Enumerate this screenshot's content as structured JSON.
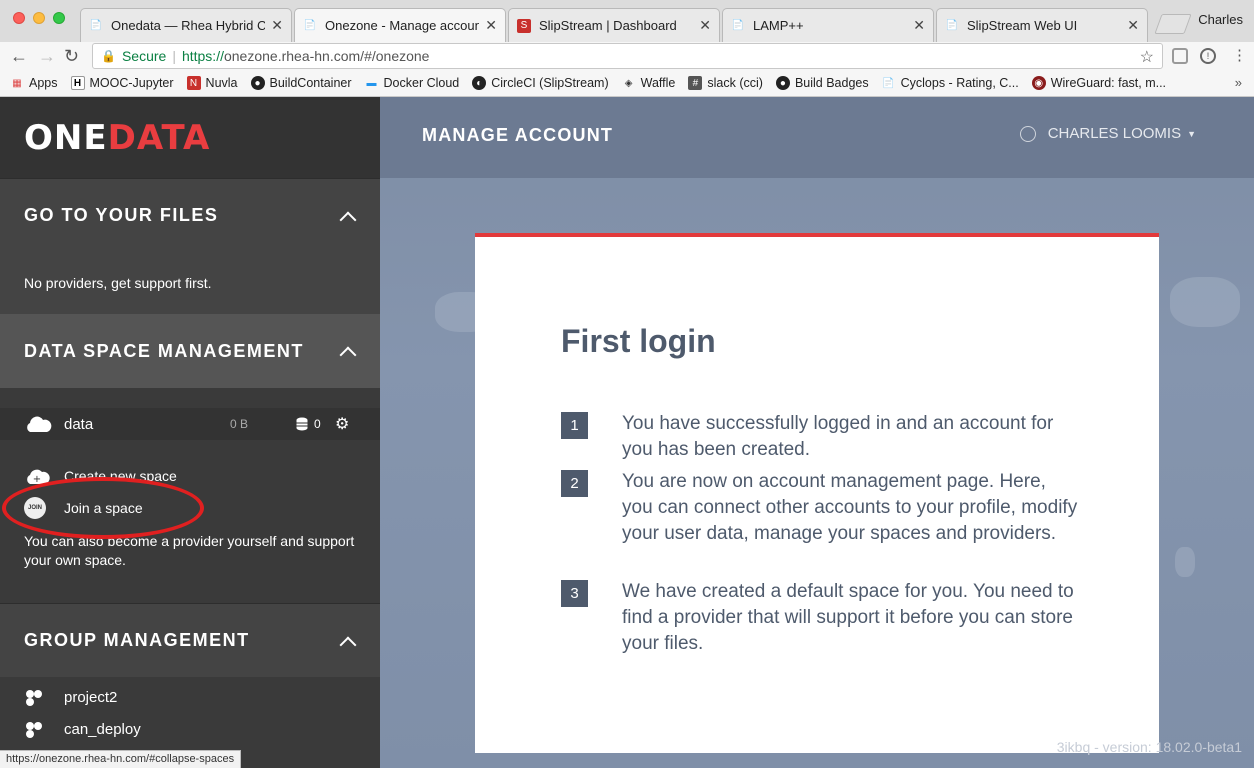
{
  "browser": {
    "profile": "Charles",
    "tabs": [
      {
        "title": "Onedata — Rhea Hybrid Clo",
        "icon": "page-icon",
        "active": false
      },
      {
        "title": "Onezone - Manage account",
        "icon": "page-icon",
        "active": true
      },
      {
        "title": "SlipStream | Dashboard",
        "icon": "slipstream-icon",
        "active": false
      },
      {
        "title": "LAMP++",
        "icon": "page-icon",
        "active": false
      },
      {
        "title": "SlipStream Web UI",
        "icon": "page-icon",
        "active": false
      }
    ],
    "secure_label": "Secure",
    "url_scheme": "https://",
    "url_rest": "onezone.rhea-hn.com/#/onezone",
    "bookmarks": [
      {
        "label": "Apps",
        "icon": "apps-grid-icon"
      },
      {
        "label": "MOOC-Jupyter",
        "icon": "jupyter-icon"
      },
      {
        "label": "Nuvla",
        "icon": "nuvla-icon"
      },
      {
        "label": "BuildContainer",
        "icon": "github-icon"
      },
      {
        "label": "Docker Cloud",
        "icon": "docker-icon"
      },
      {
        "label": "CircleCI (SlipStream)",
        "icon": "circleci-icon"
      },
      {
        "label": "Waffle",
        "icon": "waffle-icon"
      },
      {
        "label": "slack (cci)",
        "icon": "slack-icon"
      },
      {
        "label": "Build Badges",
        "icon": "github-icon"
      },
      {
        "label": "Cyclops - Rating, C...",
        "icon": "page-icon"
      },
      {
        "label": "WireGuard: fast, m...",
        "icon": "wireguard-icon"
      }
    ],
    "status_url": "https://onezone.rhea-hn.com/#collapse-spaces"
  },
  "sidebar": {
    "logo_one": "ONE",
    "logo_data": "DATA",
    "files": {
      "title": "GO TO YOUR FILES",
      "message": "No providers, get support first."
    },
    "spaces": {
      "title": "DATA SPACE MANAGEMENT",
      "items": [
        {
          "name": "data",
          "size": "0 B",
          "providers": "0"
        }
      ],
      "create_label": "Create new space",
      "join_label": "Join a space",
      "join_icon_text": "JOIN",
      "provider_note": "You can also become a provider yourself and support your own space."
    },
    "groups": {
      "title": "GROUP MANAGEMENT",
      "items": [
        "project2",
        "can_deploy"
      ]
    }
  },
  "main": {
    "title": "MANAGE ACCOUNT",
    "user_name": "CHARLES LOOMIS",
    "card": {
      "title": "First login",
      "steps": [
        {
          "num": "1",
          "text": "You have successfully logged in and an account for you has been created."
        },
        {
          "num": "2",
          "text": "You are now on account management page. Here, you can connect other accounts to your profile, modify your user data, manage your spaces and providers."
        },
        {
          "num": "3",
          "text": "We have created a default space for you. You need to find a provider that will support it before you can store your files."
        }
      ]
    },
    "version": "3ikbq - version: 18.02.0-beta1"
  },
  "colors": {
    "accent_red": "#e93d40",
    "sidebar_bg": "#3a3a3a",
    "main_bg": "#8595ae",
    "text_dark": "#4e5a6c"
  }
}
